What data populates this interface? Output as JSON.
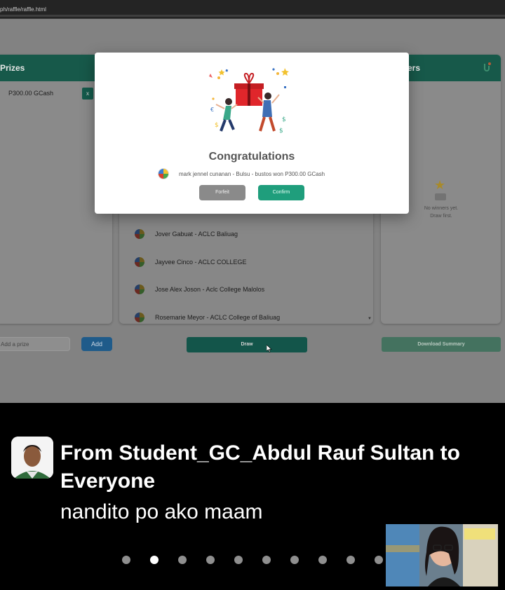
{
  "browser": {
    "url": "ph/raffle/raffle.html"
  },
  "prizes_panel": {
    "title": "Prizes",
    "items": [
      {
        "label": "P300.00 GCash",
        "remove_label": "x"
      }
    ],
    "input_placeholder": "Add a prize",
    "add_label": "Add"
  },
  "winners_panel": {
    "title": "Winners",
    "title_visible": "ers",
    "empty_line1": "No winners yet.",
    "empty_line2": "Draw first."
  },
  "participants": [
    "Jover Gabuat - ACLC Baliuag",
    "Jayvee Cinco - ACLC COLLEGE",
    "Jose Alex Joson - Aclc College Malolos",
    "Rosemarie Meyor - ACLC College of Baliuag"
  ],
  "buttons": {
    "draw": "Draw",
    "download_summary": "Download Summary"
  },
  "modal": {
    "title": "Congratulations",
    "message": "mark jennel cunanan - Bulsu - bustos won P300.00 GCash",
    "forfeit": "Forfeit",
    "confirm": "Confirm"
  },
  "chat": {
    "from": "From Student_GC_Abdul Rauf Sultan to Everyone",
    "message": "nandito po ako maam",
    "page_count": 10,
    "active_page": 2
  },
  "colors": {
    "header_green": "#17594a",
    "confirm_green": "#1f9e7c",
    "forfeit_gray": "#8a8a8a",
    "add_blue": "#1f5b8a"
  }
}
